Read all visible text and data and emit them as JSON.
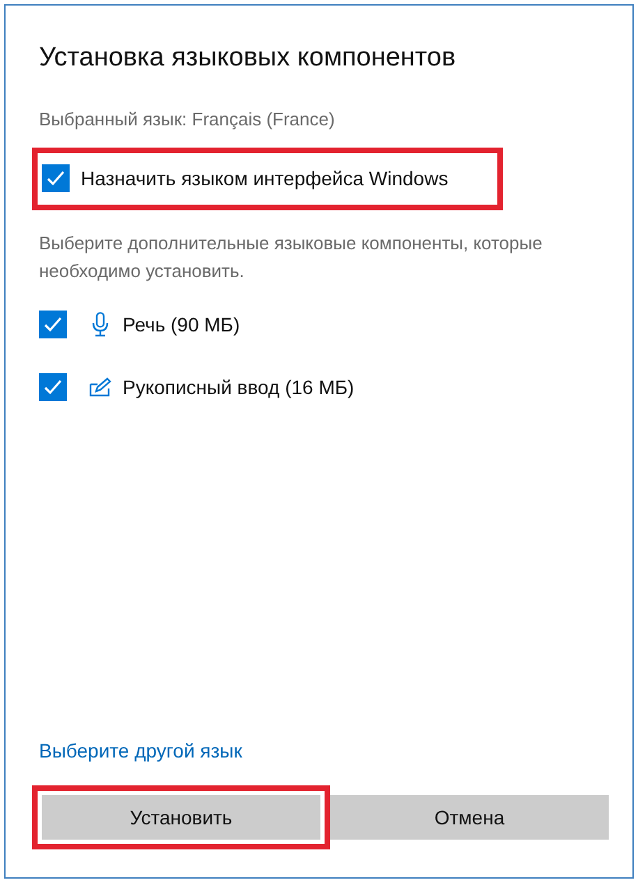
{
  "dialog": {
    "title": "Установка языковых компонентов",
    "selected_language": "Выбранный язык: Français (France)",
    "display_language": {
      "label": "Назначить языком интерфейса Windows",
      "checked": true,
      "highlighted": true
    },
    "components_hint": "Выберите дополнительные языковые компоненты, которые необходимо установить.",
    "components": [
      {
        "kind": "speech",
        "label": "Речь (90 МБ)",
        "checked": true
      },
      {
        "kind": "handwriting",
        "label": "Рукописный ввод (16 МБ)",
        "checked": true
      }
    ],
    "other_language_link": "Выберите другой язык",
    "buttons": [
      {
        "label": "Установить",
        "highlighted": true
      },
      {
        "label": "Отмена",
        "highlighted": false
      }
    ]
  }
}
